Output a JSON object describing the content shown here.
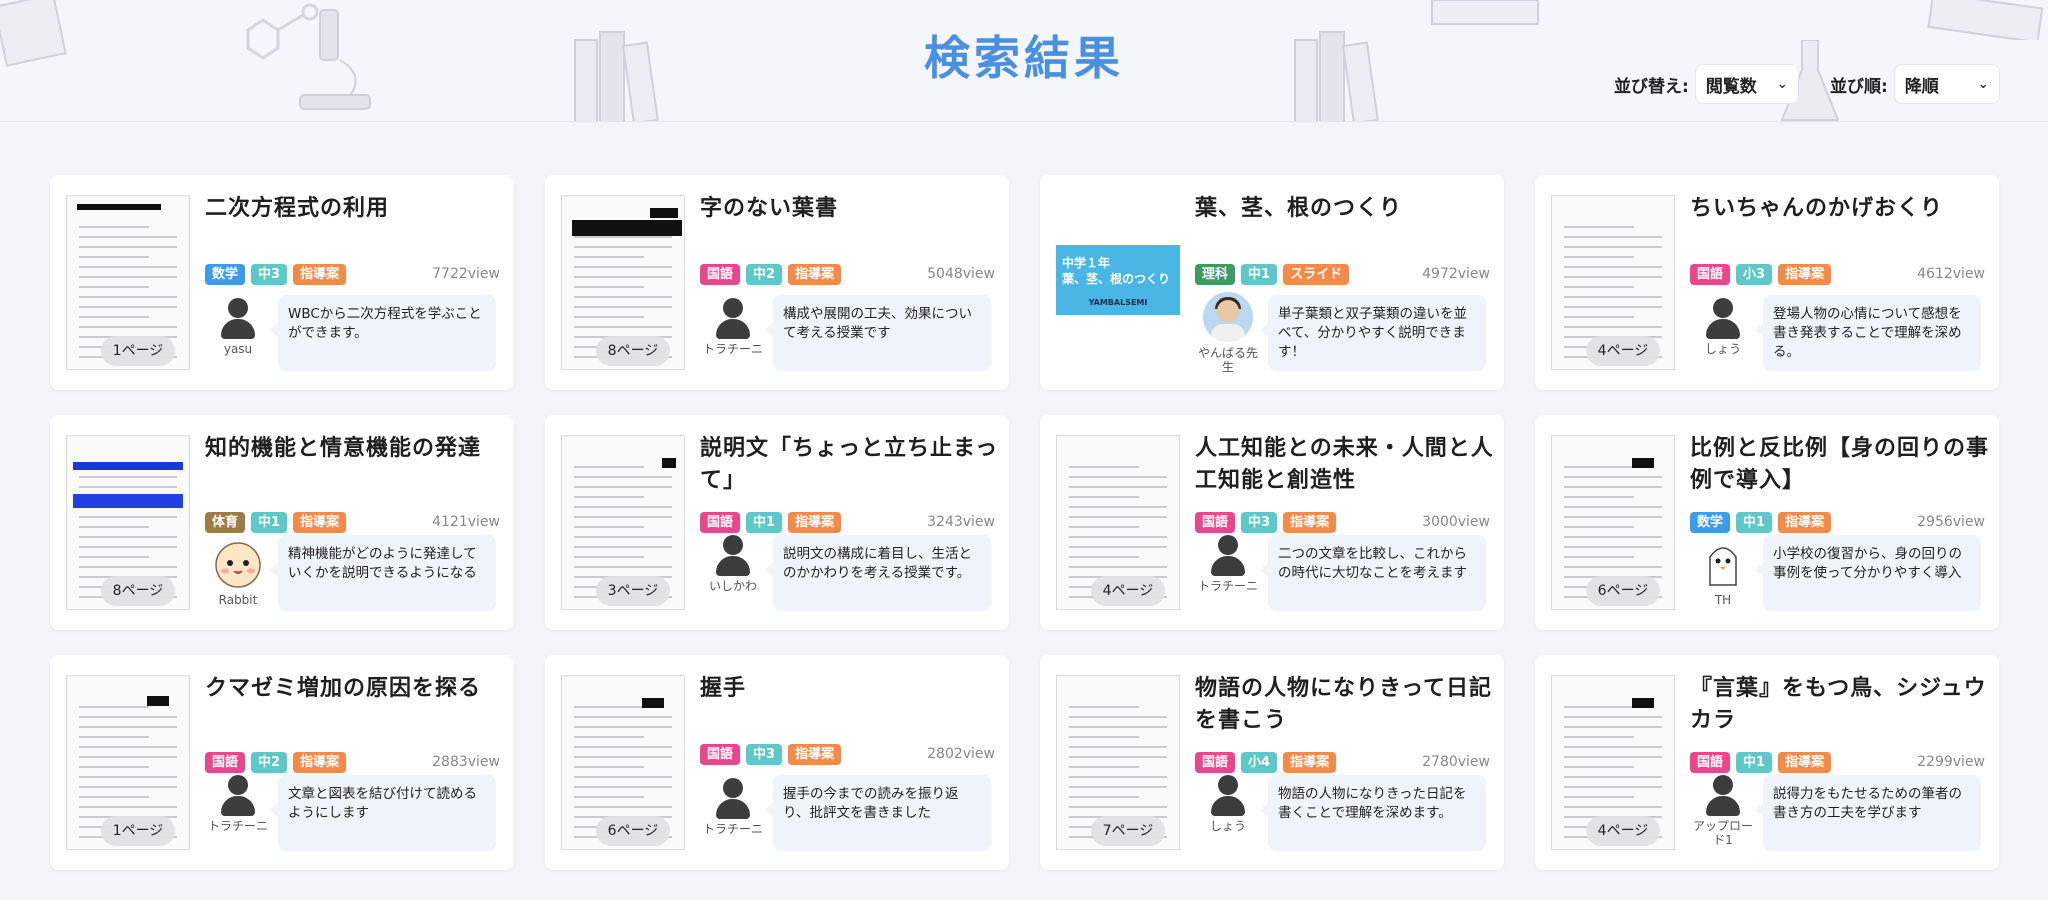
{
  "header": {
    "title": "検索結果",
    "sort_label": "並び替え:",
    "sort_value": "閲覧数",
    "order_label": "並び順:",
    "order_value": "降順"
  },
  "colors": {
    "title": "#4a8fe0",
    "tag_subject_math": "#3d9be9",
    "tag_subject_japanese": "#e8478b",
    "tag_subject_science": "#3e9a63",
    "tag_subject_pe": "#9e7b45",
    "tag_grade": "#5ec8c8",
    "tag_type": "#f28b4a"
  },
  "cards": [
    {
      "title": "二次方程式の利用",
      "subject": "数学",
      "grade": "中3",
      "type": "指導案",
      "views": "7722view",
      "pages": "1ページ",
      "author": "yasu",
      "desc": "WBCから二次方程式を学ぶことができます。"
    },
    {
      "title": "字のない葉書",
      "subject": "国語",
      "grade": "中2",
      "type": "指導案",
      "views": "5048view",
      "pages": "8ページ",
      "author": "トラチーニ",
      "desc": "構成や展開の工夫、効果について考える授業です"
    },
    {
      "title": "葉、茎、根のつくり",
      "subject": "理科",
      "grade": "中1",
      "type": "スライド",
      "views": "4972view",
      "pages": "",
      "author": "やんばる先生",
      "desc": "単子葉類と双子葉類の違いを並べて、分かりやすく説明できます！",
      "slide_text": "中学１年\n葉、茎、根のつくり",
      "slide_foot": "YAMBALSEMI"
    },
    {
      "title": "ちいちゃんのかげおくり",
      "subject": "国語",
      "grade": "小3",
      "type": "指導案",
      "views": "4612view",
      "pages": "4ページ",
      "author": "しょう",
      "desc": "登場人物の心情について感想を書き発表することで理解を深める。"
    },
    {
      "title": "知的機能と情意機能の発達",
      "subject": "体育",
      "grade": "中1",
      "type": "指導案",
      "views": "4121view",
      "pages": "8ページ",
      "author": "Rabbit",
      "desc": "精神機能がどのように発達していくかを説明できるようになる"
    },
    {
      "title": "説明文「ちょっと立ち止まって」",
      "subject": "国語",
      "grade": "中1",
      "type": "指導案",
      "views": "3243view",
      "pages": "3ページ",
      "author": "いしかわ",
      "desc": "説明文の構成に着目し、生活とのかかわりを考える授業です。"
    },
    {
      "title": "人工知能との未来・人間と人工知能と創造性",
      "subject": "国語",
      "grade": "中3",
      "type": "指導案",
      "views": "3000view",
      "pages": "4ページ",
      "author": "トラチーニ",
      "desc": "二つの文章を比較し、これからの時代に大切なことを考えます"
    },
    {
      "title": "比例と反比例【身の回りの事例で導入】",
      "subject": "数学",
      "grade": "中1",
      "type": "指導案",
      "views": "2956view",
      "pages": "6ページ",
      "author": "TH",
      "desc": "小学校の復習から、身の回りの事例を使って分かりやすく導入"
    },
    {
      "title": "クマゼミ増加の原因を探る",
      "subject": "国語",
      "grade": "中2",
      "type": "指導案",
      "views": "2883view",
      "pages": "1ページ",
      "author": "トラチーニ",
      "desc": "文章と図表を結び付けて読めるようにします"
    },
    {
      "title": "握手",
      "subject": "国語",
      "grade": "中3",
      "type": "指導案",
      "views": "2802view",
      "pages": "6ページ",
      "author": "トラチーニ",
      "desc": "握手の今までの読みを振り返り、批評文を書きました"
    },
    {
      "title": "物語の人物になりきって日記を書こう",
      "subject": "国語",
      "grade": "小4",
      "type": "指導案",
      "views": "2780view",
      "pages": "7ページ",
      "author": "しょう",
      "desc": "物語の人物になりきった日記を書くことで理解を深めます。"
    },
    {
      "title": "『言葉』をもつ鳥、シジュウカラ",
      "subject": "国語",
      "grade": "中1",
      "type": "指導案",
      "views": "2299view",
      "pages": "4ページ",
      "author": "アップロード1",
      "desc": "説得力をもたせるための筆者の書き方の工夫を学びます"
    }
  ]
}
